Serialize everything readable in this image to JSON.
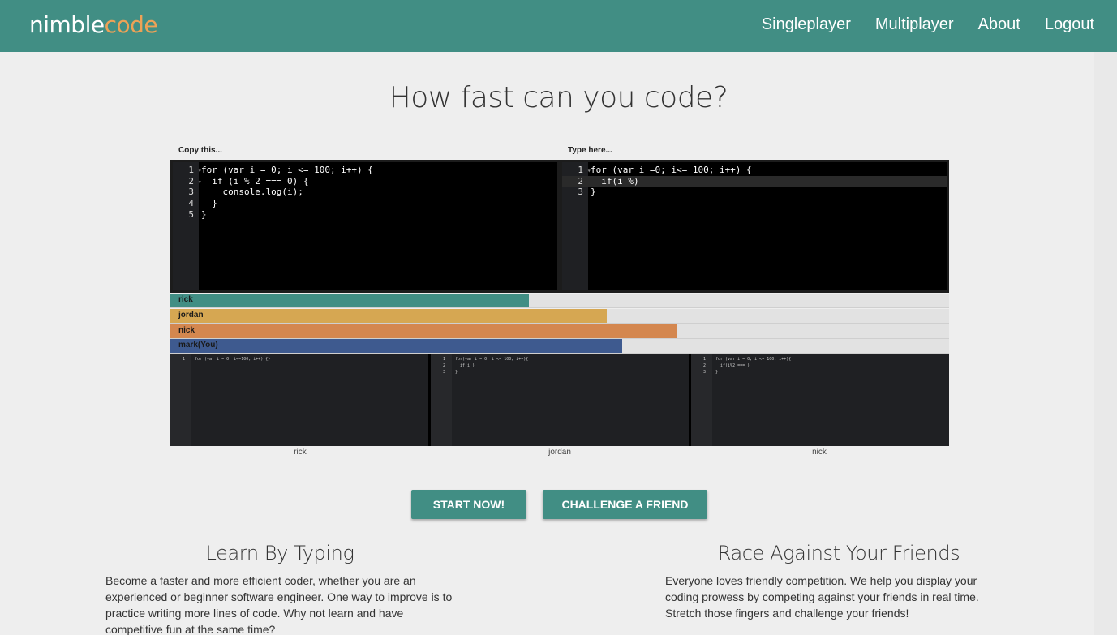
{
  "navbar": {
    "brand_part1": "nimble",
    "brand_part2": "code",
    "links": [
      "Singleplayer",
      "Multiplayer",
      "About",
      "Logout"
    ],
    "bg_color": "#418e84",
    "accent_color": "#eea256"
  },
  "hero": {
    "title": "How fast can you code?"
  },
  "editors": {
    "source_label": "Copy this...",
    "target_label": "Type here...",
    "source_lines": [
      {
        "n": "1",
        "fold": true,
        "code": "for (var i = 0; i <= 100; i++) {"
      },
      {
        "n": "2",
        "fold": true,
        "code": "  if (i % 2 === 0) {"
      },
      {
        "n": "3",
        "fold": false,
        "code": "    console.log(i);"
      },
      {
        "n": "4",
        "fold": false,
        "code": "  }"
      },
      {
        "n": "5",
        "fold": false,
        "code": "}"
      }
    ],
    "target_lines": [
      {
        "n": "1",
        "fold": true,
        "code": "for (var i =0; i<= 100; i++) {"
      },
      {
        "n": "2",
        "fold": false,
        "code": "  if(i %)"
      },
      {
        "n": "3",
        "fold": false,
        "code": "}"
      }
    ]
  },
  "players": [
    {
      "name": "rick",
      "progress": 0.46,
      "color": "#418e84"
    },
    {
      "name": "jordan",
      "progress": 0.56,
      "color": "#d6a752"
    },
    {
      "name": "nick",
      "progress": 0.65,
      "color": "#d4874f"
    },
    {
      "name": "mark(You)",
      "progress": 0.58,
      "color": "#3e5a8f"
    }
  ],
  "opponent_editors": [
    {
      "label": "rick",
      "lines": [
        {
          "n": "1",
          "code": "for (var i = 0; i<=100; i++) {}"
        }
      ]
    },
    {
      "label": "jordan",
      "lines": [
        {
          "n": "1",
          "code": "for(var i = 0; i <= 100; i++){"
        },
        {
          "n": "2",
          "code": "  if(i )"
        },
        {
          "n": "3",
          "code": "}"
        }
      ]
    },
    {
      "label": "nick",
      "lines": [
        {
          "n": "1",
          "code": "for (var i = 0; i <= 100; i++){"
        },
        {
          "n": "2",
          "code": "  if(i%2 === )"
        },
        {
          "n": "3",
          "code": "}"
        }
      ]
    }
  ],
  "buttons": {
    "start": "START NOW!",
    "challenge": "CHALLENGE A FRIEND"
  },
  "features": [
    {
      "title": "Learn By Typing",
      "text": "Become a faster and more efficient coder, whether you are an experienced or beginner software engineer. One way to improve is to practice writing more lines of code. Why not learn and have competitive fun at the same time?"
    },
    {
      "title": "Race Against Your Friends",
      "text": "Everyone loves friendly competition. We help you display your coding prowess by competing against your friends in real time. Stretch those fingers and challenge your friends!"
    }
  ]
}
